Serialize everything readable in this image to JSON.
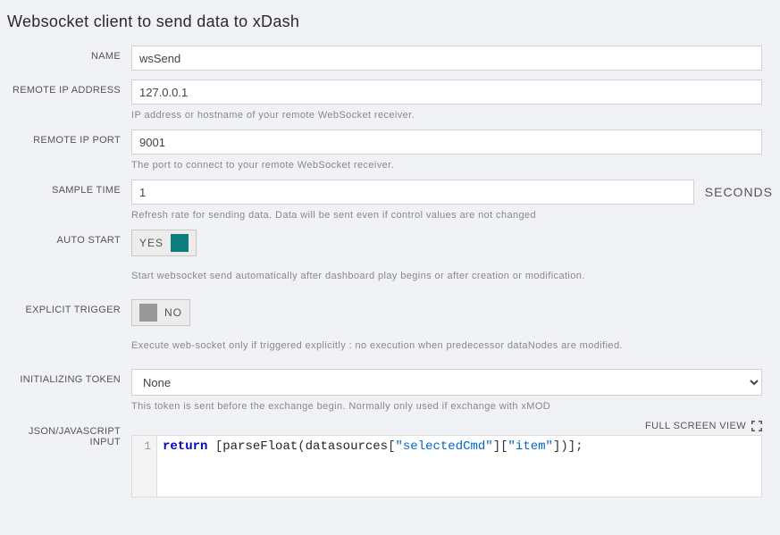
{
  "title": "Websocket client to send data to xDash",
  "sample_time_unit": "SECONDS",
  "fields": {
    "name": {
      "label": "NAME",
      "value": "wsSend"
    },
    "remote_ip": {
      "label": "REMOTE IP ADDRESS",
      "value": "127.0.0.1",
      "hint": "IP address or hostname of your remote WebSocket receiver."
    },
    "remote_port": {
      "label": "REMOTE IP PORT",
      "value": "9001",
      "hint": "The port to connect to your remote WebSocket receiver."
    },
    "sample_time": {
      "label": "SAMPLE TIME",
      "value": "1",
      "hint": "Refresh rate for sending data. Data will be sent even if control values are not changed"
    },
    "auto_start": {
      "label": "AUTO START",
      "state": "YES",
      "hint": "Start websocket send automatically after dashboard play begins or after creation or modification."
    },
    "explicit_trigger": {
      "label": "EXPLICIT TRIGGER",
      "state": "NO",
      "hint": "Execute web-socket only if triggered explicitly : no execution when predecessor dataNodes are modified."
    },
    "init_token": {
      "label": "INITIALIZING TOKEN",
      "value": "None",
      "hint": "This token is sent before the exchange begin. Normally only used if exchange with xMOD"
    },
    "js_input": {
      "label": "JSON/JAVASCRIPT INPUT",
      "fullscreen": "FULL SCREEN VIEW"
    }
  },
  "code": {
    "line_number": "1",
    "tokens": {
      "kw": "return",
      "sp1": " [",
      "fn": "parseFloat",
      "p1": "(",
      "id": "datasources",
      "b1": "[",
      "s1": "\"selectedCmd\"",
      "b2": "][",
      "s2": "\"item\"",
      "b3": "])];"
    }
  }
}
